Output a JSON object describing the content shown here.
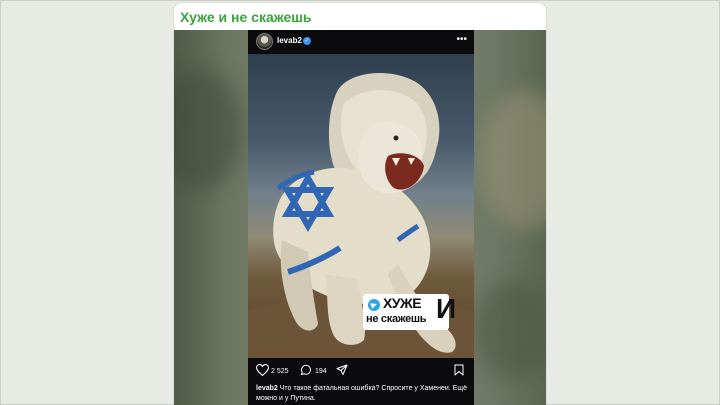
{
  "channel": {
    "title": "Хуже и не скажешь"
  },
  "post": {
    "username": "levab2",
    "verified": true,
    "likes": "2 525",
    "comments": "194",
    "caption_user": "levab2",
    "caption_text": "Что такое фатальная ошибка? Спросите у Хаменеи. Ещё можно и у Путина."
  },
  "watermark": {
    "line1": "ХУЖЕ",
    "line2": "не скажешь",
    "big_letter": "И"
  },
  "icons": {
    "more": "more-dots-icon",
    "like": "heart-icon",
    "comment": "comment-icon",
    "share": "send-icon",
    "save": "bookmark-icon",
    "watermark": "telegram-icon"
  },
  "colors": {
    "channel_title": "#3aa53c",
    "verified": "#3d8ff0",
    "flag_blue": "#2f67b6",
    "telegram": "#2ea4e2"
  }
}
